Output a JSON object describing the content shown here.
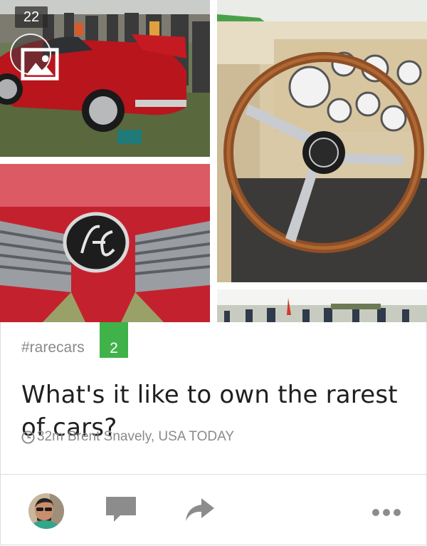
{
  "gallery": {
    "photo_count": "22",
    "gallery_icon": "image-gallery-icon",
    "photos": [
      {
        "subject": "red-sports-car-at-show"
      },
      {
        "subject": "wooden-steering-wheel-dashboard"
      },
      {
        "subject": "ac-badge-grille"
      },
      {
        "subject": "crowd-at-car-show"
      }
    ]
  },
  "card": {
    "topic": "#rarecars",
    "comment_count": "2",
    "headline": "What's it like to own the rarest of cars?",
    "time_ago": "32m",
    "source": "Brent Snavely, USA TODAY"
  },
  "actions": {
    "avatar_icon": "user-avatar",
    "comment_icon": "comment-icon",
    "share_icon": "share-arrow-icon",
    "more_icon": "more-dots-icon"
  },
  "colors": {
    "accent_green": "#3fb24a",
    "meta_gray": "#8a8a8a",
    "headline": "#1f1f1f",
    "icon_gray": "#8c8c8c"
  }
}
